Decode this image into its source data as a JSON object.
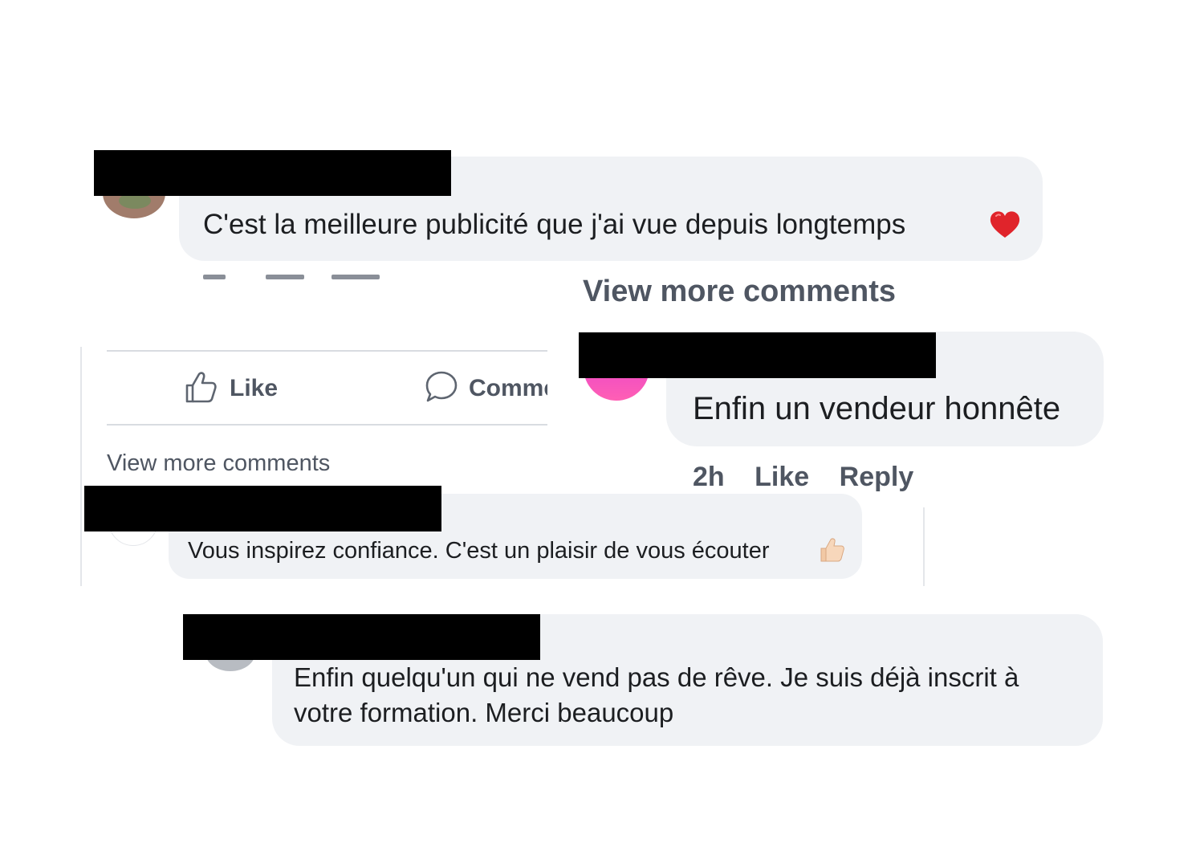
{
  "comment1": {
    "text": "C'est la meilleure publicité que j'ai vue depuis longtemps",
    "emoji": "red-heart-icon"
  },
  "view_more_right": "View more comments",
  "comment2": {
    "text": "Enfin un vendeur honnête",
    "time": "2h",
    "like": "Like",
    "reply": "Reply"
  },
  "post_actions": {
    "like": "Like",
    "comment": "Comme"
  },
  "view_more_left": "View more comments",
  "comment3": {
    "text": "Vous inspirez confiance. C'est un plaisir de vous écouter",
    "emoji": "thumbs-up-icon"
  },
  "comment4": {
    "line1": "Enfin quelqu'un qui ne vend pas de rêve. Je suis déjà inscrit à",
    "line2": "votre formation. Merci beaucoup"
  },
  "colors": {
    "bubble": "#f0f2f5",
    "muted_text": "#4f5662",
    "redaction": "#000000"
  }
}
